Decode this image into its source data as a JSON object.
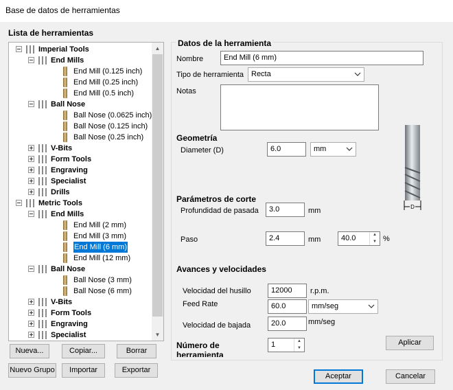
{
  "window": {
    "title": "Base de datos de herramientas"
  },
  "tree": {
    "heading": "Lista de herramientas",
    "rows": [
      {
        "label": "Imperial Tools",
        "bold": true,
        "level": 0,
        "expander": "minus",
        "selected": false
      },
      {
        "label": "End Mills",
        "bold": true,
        "level": 1,
        "expander": "minus",
        "selected": false
      },
      {
        "label": "End Mill (0.125 inch)",
        "bold": false,
        "level": 2,
        "expander": "",
        "selected": false
      },
      {
        "label": "End Mill (0.25 inch)",
        "bold": false,
        "level": 2,
        "expander": "",
        "selected": false
      },
      {
        "label": "End Mill (0.5 inch)",
        "bold": false,
        "level": 2,
        "expander": "",
        "selected": false
      },
      {
        "label": "Ball Nose",
        "bold": true,
        "level": 1,
        "expander": "minus",
        "selected": false
      },
      {
        "label": "Ball Nose (0.0625 inch)",
        "bold": false,
        "level": 2,
        "expander": "",
        "selected": false
      },
      {
        "label": "Ball Nose (0.125 inch)",
        "bold": false,
        "level": 2,
        "expander": "",
        "selected": false
      },
      {
        "label": "Ball Nose (0.25 inch)",
        "bold": false,
        "level": 2,
        "expander": "",
        "selected": false
      },
      {
        "label": "V-Bits",
        "bold": true,
        "level": 1,
        "expander": "plus",
        "selected": false
      },
      {
        "label": "Form Tools",
        "bold": true,
        "level": 1,
        "expander": "plus",
        "selected": false
      },
      {
        "label": "Engraving",
        "bold": true,
        "level": 1,
        "expander": "plus",
        "selected": false
      },
      {
        "label": "Specialist",
        "bold": true,
        "level": 1,
        "expander": "plus",
        "selected": false
      },
      {
        "label": "Drills",
        "bold": true,
        "level": 1,
        "expander": "plus",
        "selected": false
      },
      {
        "label": "Metric Tools",
        "bold": true,
        "level": 0,
        "expander": "minus",
        "selected": false
      },
      {
        "label": "End Mills",
        "bold": true,
        "level": 1,
        "expander": "minus",
        "selected": false
      },
      {
        "label": "End Mill (2 mm)",
        "bold": false,
        "level": 2,
        "expander": "",
        "selected": false
      },
      {
        "label": "End Mill (3 mm)",
        "bold": false,
        "level": 2,
        "expander": "",
        "selected": false
      },
      {
        "label": "End Mill (6 mm)",
        "bold": false,
        "level": 2,
        "expander": "",
        "selected": true
      },
      {
        "label": "End Mill (12 mm)",
        "bold": false,
        "level": 2,
        "expander": "",
        "selected": false
      },
      {
        "label": "Ball Nose",
        "bold": true,
        "level": 1,
        "expander": "minus",
        "selected": false
      },
      {
        "label": "Ball Nose (3 mm)",
        "bold": false,
        "level": 2,
        "expander": "",
        "selected": false
      },
      {
        "label": "Ball Nose (6 mm)",
        "bold": false,
        "level": 2,
        "expander": "",
        "selected": false
      },
      {
        "label": "V-Bits",
        "bold": true,
        "level": 1,
        "expander": "plus",
        "selected": false
      },
      {
        "label": "Form Tools",
        "bold": true,
        "level": 1,
        "expander": "plus",
        "selected": false
      },
      {
        "label": "Engraving",
        "bold": true,
        "level": 1,
        "expander": "plus",
        "selected": false
      },
      {
        "label": "Specialist",
        "bold": true,
        "level": 1,
        "expander": "plus",
        "selected": false
      }
    ]
  },
  "left_buttons": {
    "new": "Nueva...",
    "copy": "Copiar...",
    "delete": "Borrar",
    "new_group": "Nuevo Grupo",
    "import": "Importar",
    "export": "Exportar"
  },
  "tool_data": {
    "heading": "Datos de la herramienta",
    "name_label": "Nombre",
    "name_value": "End Mill (6 mm)",
    "type_label": "Tipo de herramienta",
    "type_value": "Recta",
    "notes_label": "Notas",
    "notes_value": ""
  },
  "geometry": {
    "heading": "Geometría",
    "diameter_label": "Diameter (D)",
    "diameter_value": "6.0",
    "unit_value": "mm",
    "diagram_label": "D"
  },
  "cut_params": {
    "heading": "Parámetros de corte",
    "pass_depth_label": "Profundidad de pasada",
    "pass_depth_value": "3.0",
    "pass_depth_unit": "mm",
    "stepover_label": "Paso",
    "stepover_value": "2.4",
    "stepover_unit": "mm",
    "stepover_percent_value": "40.0",
    "percent_sign": "%"
  },
  "feeds": {
    "heading": "Avances y velocidades",
    "spindle_label": "Velocidad del husillo",
    "spindle_value": "12000",
    "spindle_unit": "r.p.m.",
    "feed_label": "Feed Rate",
    "feed_value": "60.0",
    "feed_unit": "mm/seg",
    "plunge_label": "Velocidad de bajada",
    "plunge_value": "20.0",
    "plunge_unit": "mm/seg"
  },
  "tool_number": {
    "label": "Número de herramienta",
    "value": "1"
  },
  "actions": {
    "apply": "Aplicar",
    "accept": "Aceptar",
    "cancel": "Cancelar"
  },
  "colors": {
    "selection": "#0078d7",
    "dialog_bg": "#f0f0f0",
    "bit_gold": "#d9b574"
  }
}
